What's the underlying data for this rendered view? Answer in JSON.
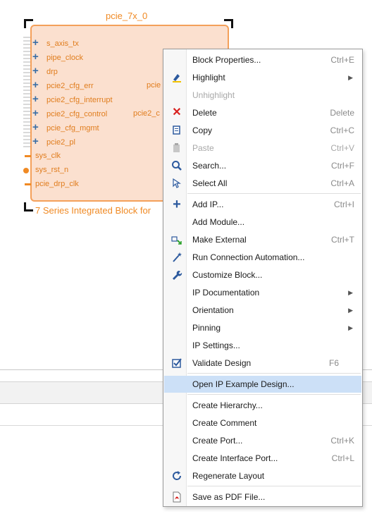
{
  "block": {
    "name": "pcie_7x_0",
    "caption": "7 Series Integrated Block for",
    "interfaces": [
      "s_axis_tx",
      "pipe_clock",
      "drp",
      "pcie2_cfg_err",
      "pcie2_cfg_interrupt",
      "pcie2_cfg_control",
      "pcie_cfg_mgmt",
      "pcie2_pl"
    ],
    "ports": [
      "sys_clk",
      "sys_rst_n",
      "pcie_drp_clk"
    ],
    "right_labels": [
      "pcie",
      "pcie2_c"
    ]
  },
  "menu": {
    "items": [
      {
        "label": "Block Properties...",
        "shortcut": "Ctrl+E",
        "icon": "",
        "enabled": true
      },
      {
        "label": "Highlight",
        "shortcut": "",
        "submenu": true,
        "icon": "highlight-icon",
        "enabled": true
      },
      {
        "label": "Unhighlight",
        "shortcut": "",
        "icon": "",
        "enabled": false
      },
      {
        "label": "Delete",
        "shortcut": "Delete",
        "icon": "delete-icon",
        "enabled": true
      },
      {
        "label": "Copy",
        "shortcut": "Ctrl+C",
        "icon": "copy-icon",
        "enabled": true
      },
      {
        "label": "Paste",
        "shortcut": "Ctrl+V",
        "icon": "paste-icon",
        "enabled": false
      },
      {
        "label": "Search...",
        "shortcut": "Ctrl+F",
        "icon": "search-icon",
        "enabled": true
      },
      {
        "label": "Select All",
        "shortcut": "Ctrl+A",
        "icon": "select-all-icon",
        "enabled": true
      },
      {
        "label": "Add IP...",
        "shortcut": "Ctrl+I",
        "icon": "add-icon",
        "enabled": true
      },
      {
        "label": "Add Module...",
        "shortcut": "",
        "icon": "",
        "enabled": true
      },
      {
        "label": "Make External",
        "shortcut": "Ctrl+T",
        "icon": "make-external-icon",
        "enabled": true
      },
      {
        "label": "Run Connection Automation...",
        "shortcut": "",
        "icon": "wand-icon",
        "enabled": true
      },
      {
        "label": "Customize Block...",
        "shortcut": "",
        "icon": "wrench-icon",
        "enabled": true
      },
      {
        "label": "IP Documentation",
        "shortcut": "",
        "submenu": true,
        "icon": "",
        "enabled": true
      },
      {
        "label": "Orientation",
        "shortcut": "",
        "submenu": true,
        "icon": "",
        "enabled": true
      },
      {
        "label": "Pinning",
        "shortcut": "",
        "submenu": true,
        "icon": "",
        "enabled": true
      },
      {
        "label": "IP Settings...",
        "shortcut": "",
        "icon": "",
        "enabled": true
      },
      {
        "label": "Validate Design",
        "shortcut": "F6",
        "icon": "validate-icon",
        "enabled": true
      },
      {
        "label": "Open IP Example Design...",
        "shortcut": "",
        "icon": "",
        "enabled": true,
        "highlighted": true
      },
      {
        "label": "Create Hierarchy...",
        "shortcut": "",
        "icon": "",
        "enabled": true
      },
      {
        "label": "Create Comment",
        "shortcut": "",
        "icon": "",
        "enabled": true
      },
      {
        "label": "Create Port...",
        "shortcut": "Ctrl+K",
        "icon": "",
        "enabled": true
      },
      {
        "label": "Create Interface Port...",
        "shortcut": "Ctrl+L",
        "icon": "",
        "enabled": true
      },
      {
        "label": "Regenerate Layout",
        "shortcut": "",
        "icon": "refresh-icon",
        "enabled": true
      },
      {
        "label": "Save as PDF File...",
        "shortcut": "",
        "icon": "pdf-icon",
        "enabled": true
      }
    ]
  },
  "colors": {
    "block_fill": "#fbe0cf",
    "block_border": "#f4a05a",
    "port_text": "#e07d1e",
    "menu_highlight": "#cce0f7"
  }
}
